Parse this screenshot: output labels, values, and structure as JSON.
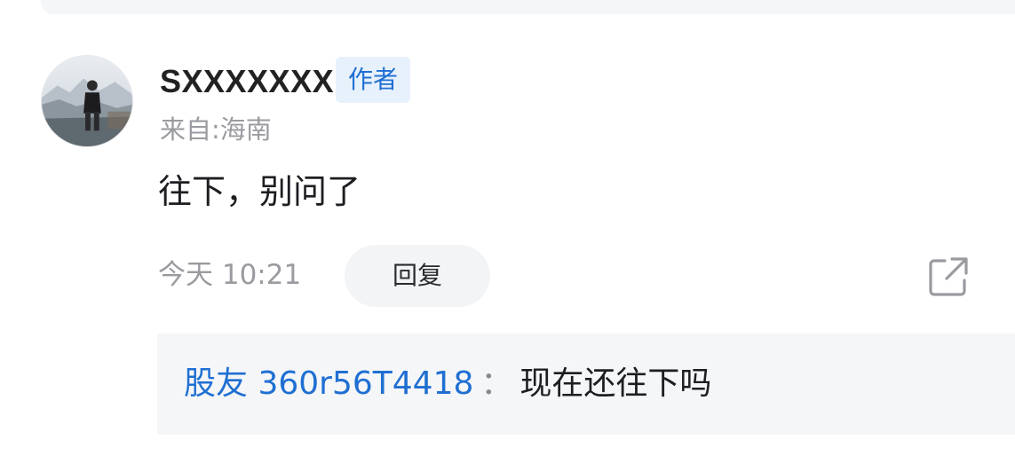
{
  "comment": {
    "username": "SXXXXXXX",
    "author_badge": "作者",
    "location": "来自:海南",
    "content": "往下，别问了",
    "time": "今天 10:21",
    "reply_label": "回复",
    "share_icon": "share-external-icon",
    "avatar_icon": "user-avatar"
  },
  "sub_reply": {
    "username": "股友 360r56T4418",
    "separator": "：",
    "message": "现在还往下吗"
  },
  "colors": {
    "accent": "#1f6fd2",
    "badge_bg": "#e7f1fc",
    "muted_text": "#9a9ba0",
    "panel_bg": "#f5f6f8"
  }
}
